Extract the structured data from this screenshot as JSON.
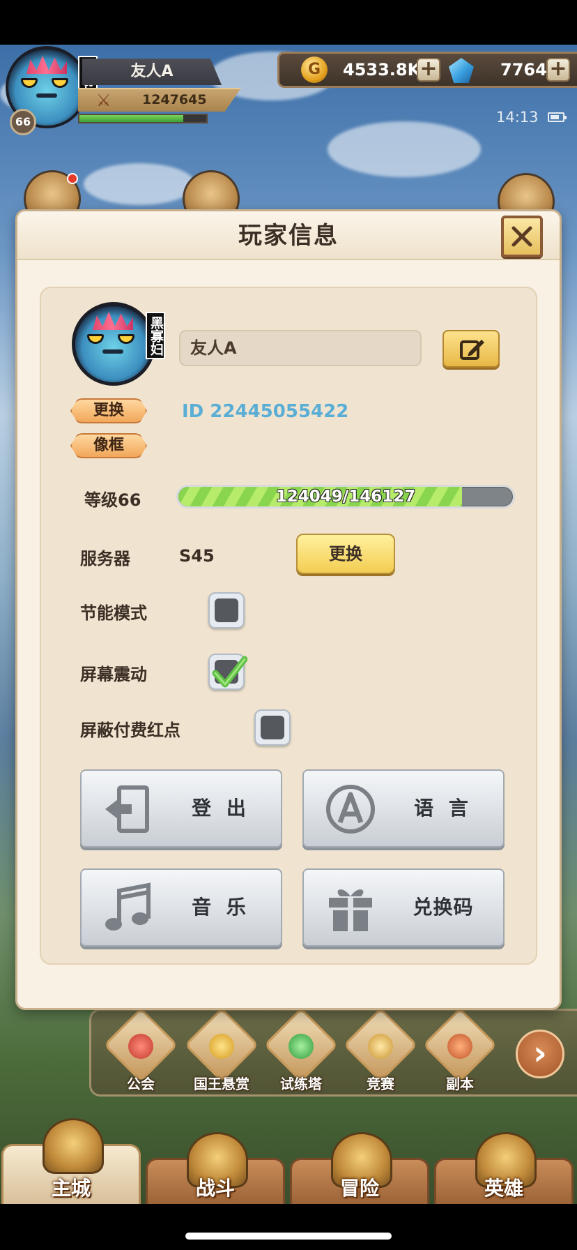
{
  "hud": {
    "player_name": "友人A",
    "avatar_badge": "黑寡妇",
    "level": "66",
    "power": "1247645",
    "exp_fraction": 0.82,
    "gold": "4533.8K",
    "gems": "7764",
    "clock": "14:13",
    "gold_icon_glyph": "G",
    "plus_glyph": "+"
  },
  "modal": {
    "title": "玩家信息",
    "close_glyph": "✕",
    "player_name_value": "友人A",
    "change_avatar_label": "更换",
    "avatar_frame_label": "像框",
    "player_id": "ID 22445055422",
    "level_label": "等级66",
    "exp_text": "124049/146127",
    "exp_current": 124049,
    "exp_total": 146127,
    "server_label": "服务器",
    "server_value": "S45",
    "change_server_label": "更换",
    "settings": [
      {
        "label": "节能模式",
        "checked": false
      },
      {
        "label": "屏幕震动",
        "checked": true
      },
      {
        "label": "屏蔽付费红点",
        "checked": false
      }
    ],
    "buttons": {
      "logout": "登 出",
      "language": "语 言",
      "music": "音 乐",
      "redeem_code": "兑换码"
    },
    "icons": {
      "logout": "logout-icon",
      "language": "language-a-icon",
      "music": "music-note-icon",
      "redeem_code": "gift-icon",
      "edit": "edit-pencil-icon",
      "close": "close-x-icon"
    }
  },
  "feature_row": {
    "items": [
      "公会",
      "国王悬赏",
      "试练塔",
      "竞赛",
      "副本"
    ],
    "next_glyph": "›"
  },
  "bottom_nav": {
    "tabs": [
      "主城",
      "战斗",
      "冒险",
      "英雄"
    ],
    "active_index": 0
  },
  "colors": {
    "modal_bg": "#f8f1e4",
    "panel_bg": "#f0e4d0",
    "id_text": "#5aaed6",
    "exp_fill": "#8ad54e",
    "yellow_button": "#f3cd52",
    "checkbox_check": "#5fc046"
  }
}
